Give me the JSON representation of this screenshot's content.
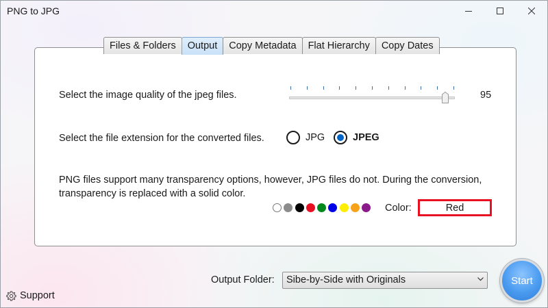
{
  "window": {
    "title": "PNG to JPG",
    "controls": [
      "minimize-icon",
      "maximize-icon",
      "close-icon"
    ]
  },
  "tabs": [
    {
      "label": "Files & Folders",
      "active": false
    },
    {
      "label": "Output",
      "active": true
    },
    {
      "label": "Copy Metadata",
      "active": false
    },
    {
      "label": "Flat Hierarchy",
      "active": false
    },
    {
      "label": "Copy Dates",
      "active": false
    }
  ],
  "quality": {
    "label": "Select the image quality of the jpeg files.",
    "value": "95",
    "min": 0,
    "max": 100,
    "tick_count": 11,
    "tick_color": "#3a6ea5"
  },
  "extension": {
    "label": "Select the file extension for the converted files.",
    "options": [
      {
        "label": "JPG",
        "checked": false
      },
      {
        "label": "JPEG",
        "checked": true
      }
    ]
  },
  "transparency": {
    "description_line1": "PNG files support many transparency options, however, JPG files do not. During the conversion,",
    "description_line2": "transparency is replaced with a solid color.",
    "swatches": [
      {
        "name": "white",
        "color": "#ffffff"
      },
      {
        "name": "gray",
        "color": "#8c8c8c"
      },
      {
        "name": "black",
        "color": "#000000"
      },
      {
        "name": "red",
        "color": "#e81123"
      },
      {
        "name": "green",
        "color": "#008a1e"
      },
      {
        "name": "blue",
        "color": "#0000e6"
      },
      {
        "name": "yellow",
        "color": "#ffee00"
      },
      {
        "name": "orange",
        "color": "#f7a21b"
      },
      {
        "name": "purple",
        "color": "#8b1a8b"
      }
    ],
    "color_label": "Color:",
    "selected_color": "Red",
    "selected_color_hex": "#e81123"
  },
  "footer": {
    "output_folder_label": "Output Folder:",
    "output_folder_value": "Sibe-by-Side with Originals",
    "start_label": "Start",
    "support_label": "Support"
  }
}
